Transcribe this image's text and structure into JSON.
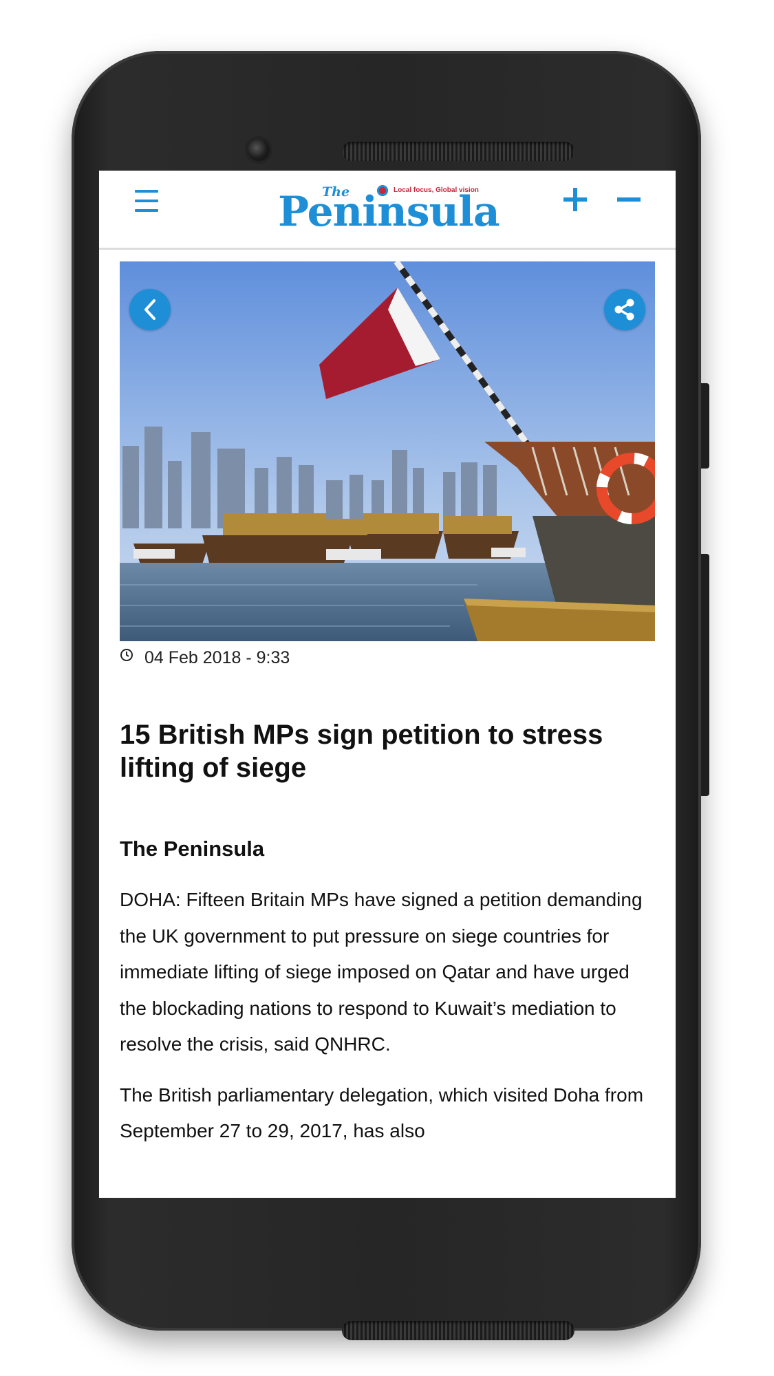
{
  "header": {
    "logo_small": "The",
    "logo_main": "Peninsula",
    "logo_tagline": "Local focus, Global vision"
  },
  "article": {
    "date": "04 Feb 2018 - 9:33",
    "title": "15 British MPs sign petition to stress lifting of siege",
    "source": "The Peninsula",
    "paragraphs": [
      "DOHA: Fifteen Britain MPs have signed a petition demanding the UK government to put pressure on siege countries for immediate lifting of siege imposed on Qatar and have urged the blockading nations to respond to Kuwait’s mediation to resolve the crisis, said QNHRC.",
      "The British parliamentary delegation, which visited Doha from  September 27 to 29, 2017, has also"
    ]
  },
  "icons": {
    "menu": "hamburger-menu-icon",
    "increase_font": "plus-icon",
    "decrease_font": "minus-icon",
    "back": "chevron-left-icon",
    "share": "share-icon",
    "timestamp": "clock-icon"
  },
  "colors": {
    "brand_blue": "#1e8fd6",
    "brand_red": "#c8243a",
    "phone_body": "#262626",
    "text": "#111111"
  }
}
